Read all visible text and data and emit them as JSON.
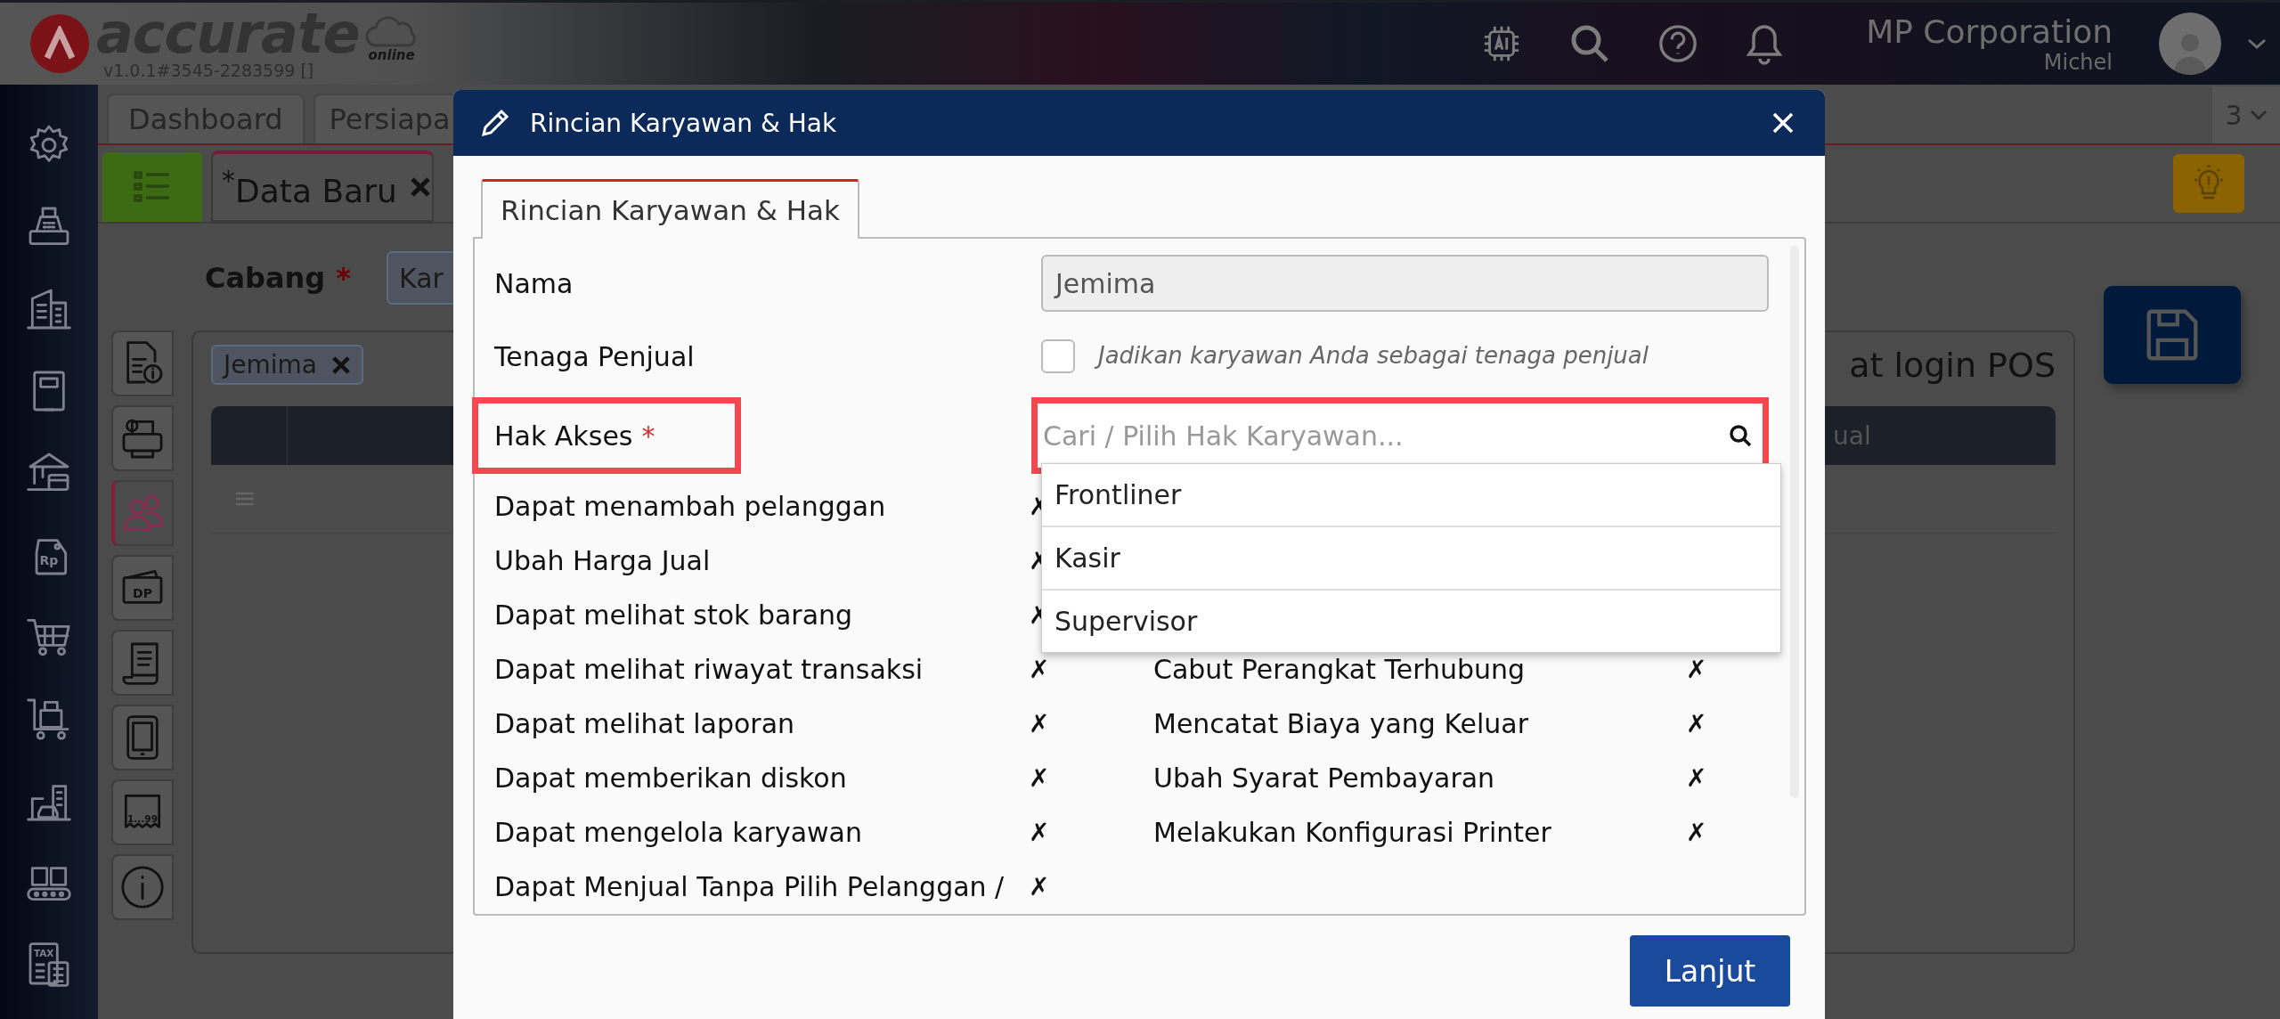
{
  "header": {
    "logo_text": "accurate",
    "logo_sub": "online",
    "version": "v1.0.1#3545-2283599 []",
    "company": "MP Corporation",
    "user": "Michel"
  },
  "sidebar": [
    {
      "kind": "gear"
    },
    {
      "kind": "cashier"
    },
    {
      "kind": "building"
    },
    {
      "kind": "book"
    },
    {
      "kind": "bank"
    },
    {
      "kind": "tag",
      "text": "Rp"
    },
    {
      "kind": "cart"
    },
    {
      "kind": "cart-box"
    },
    {
      "kind": "city"
    },
    {
      "kind": "conveyor"
    },
    {
      "kind": "tax",
      "text": "TAX"
    }
  ],
  "tabs": [
    {
      "label": "Dashboard",
      "selected": false
    },
    {
      "label": "Persiapa",
      "selected": false
    }
  ],
  "tab_overflow": "3",
  "doc_tab": {
    "prefix": "*",
    "label": "Data Baru"
  },
  "cabang": {
    "label": "Cabang",
    "required": "*",
    "value": "Kar"
  },
  "side_tabs": [
    {
      "kind": "doc-info",
      "selected": false
    },
    {
      "kind": "printer-info",
      "selected": false
    },
    {
      "kind": "people",
      "selected": true
    },
    {
      "kind": "wallet",
      "text": "DP",
      "selected": false
    },
    {
      "kind": "receipt",
      "selected": false
    },
    {
      "kind": "tablet",
      "selected": false
    },
    {
      "kind": "ticket",
      "text": "1...99",
      "selected": false
    },
    {
      "kind": "info",
      "selected": false
    }
  ],
  "panel": {
    "tag": "Jemima",
    "title": "at login POS",
    "column_header": "ual"
  },
  "modal": {
    "title": "Rincian Karyawan & Hak",
    "tabs": [
      {
        "label": "Rincian Karyawan & Hak",
        "selected": true
      }
    ],
    "nama": {
      "label": "Nama",
      "value": "Jemima",
      "disabled": true
    },
    "tenaga_penjual": {
      "label": "Tenaga Penjual",
      "checked": false,
      "hint": "Jadikan karyawan Anda sebagai tenaga penjual"
    },
    "hak_akses": {
      "label": "Hak Akses",
      "required": "*",
      "placeholder": "Cari / Pilih Hak Karyawan...",
      "highlighted": true,
      "options": [
        "Frontliner",
        "Kasir",
        "Supervisor"
      ]
    },
    "permissions": [
      {
        "left": {
          "label": "Dapat menambah pelanggan",
          "mark": "✗"
        }
      },
      {
        "left": {
          "label": "Ubah Harga Jual",
          "mark": "✗"
        }
      },
      {
        "left": {
          "label": "Dapat melihat stok barang",
          "mark": "✗"
        }
      },
      {
        "left": {
          "label": "Dapat melihat riwayat transaksi",
          "mark": "✗"
        },
        "right": {
          "label": "Cabut Perangkat Terhubung",
          "mark": "✗"
        }
      },
      {
        "left": {
          "label": "Dapat melihat laporan",
          "mark": "✗"
        },
        "right": {
          "label": "Mencatat Biaya yang Keluar",
          "mark": "✗"
        }
      },
      {
        "left": {
          "label": "Dapat memberikan diskon",
          "mark": "✗"
        },
        "right": {
          "label": "Ubah Syarat Pembayaran",
          "mark": "✗"
        }
      },
      {
        "left": {
          "label": "Dapat mengelola karyawan",
          "mark": "✗"
        },
        "right": {
          "label": "Melakukan Konfigurasi Printer",
          "mark": "✗"
        }
      },
      {
        "left": {
          "label": "Dapat Menjual Tanpa Pilih Pelanggan /",
          "mark": "✗"
        }
      }
    ],
    "submit": "Lanjut"
  }
}
